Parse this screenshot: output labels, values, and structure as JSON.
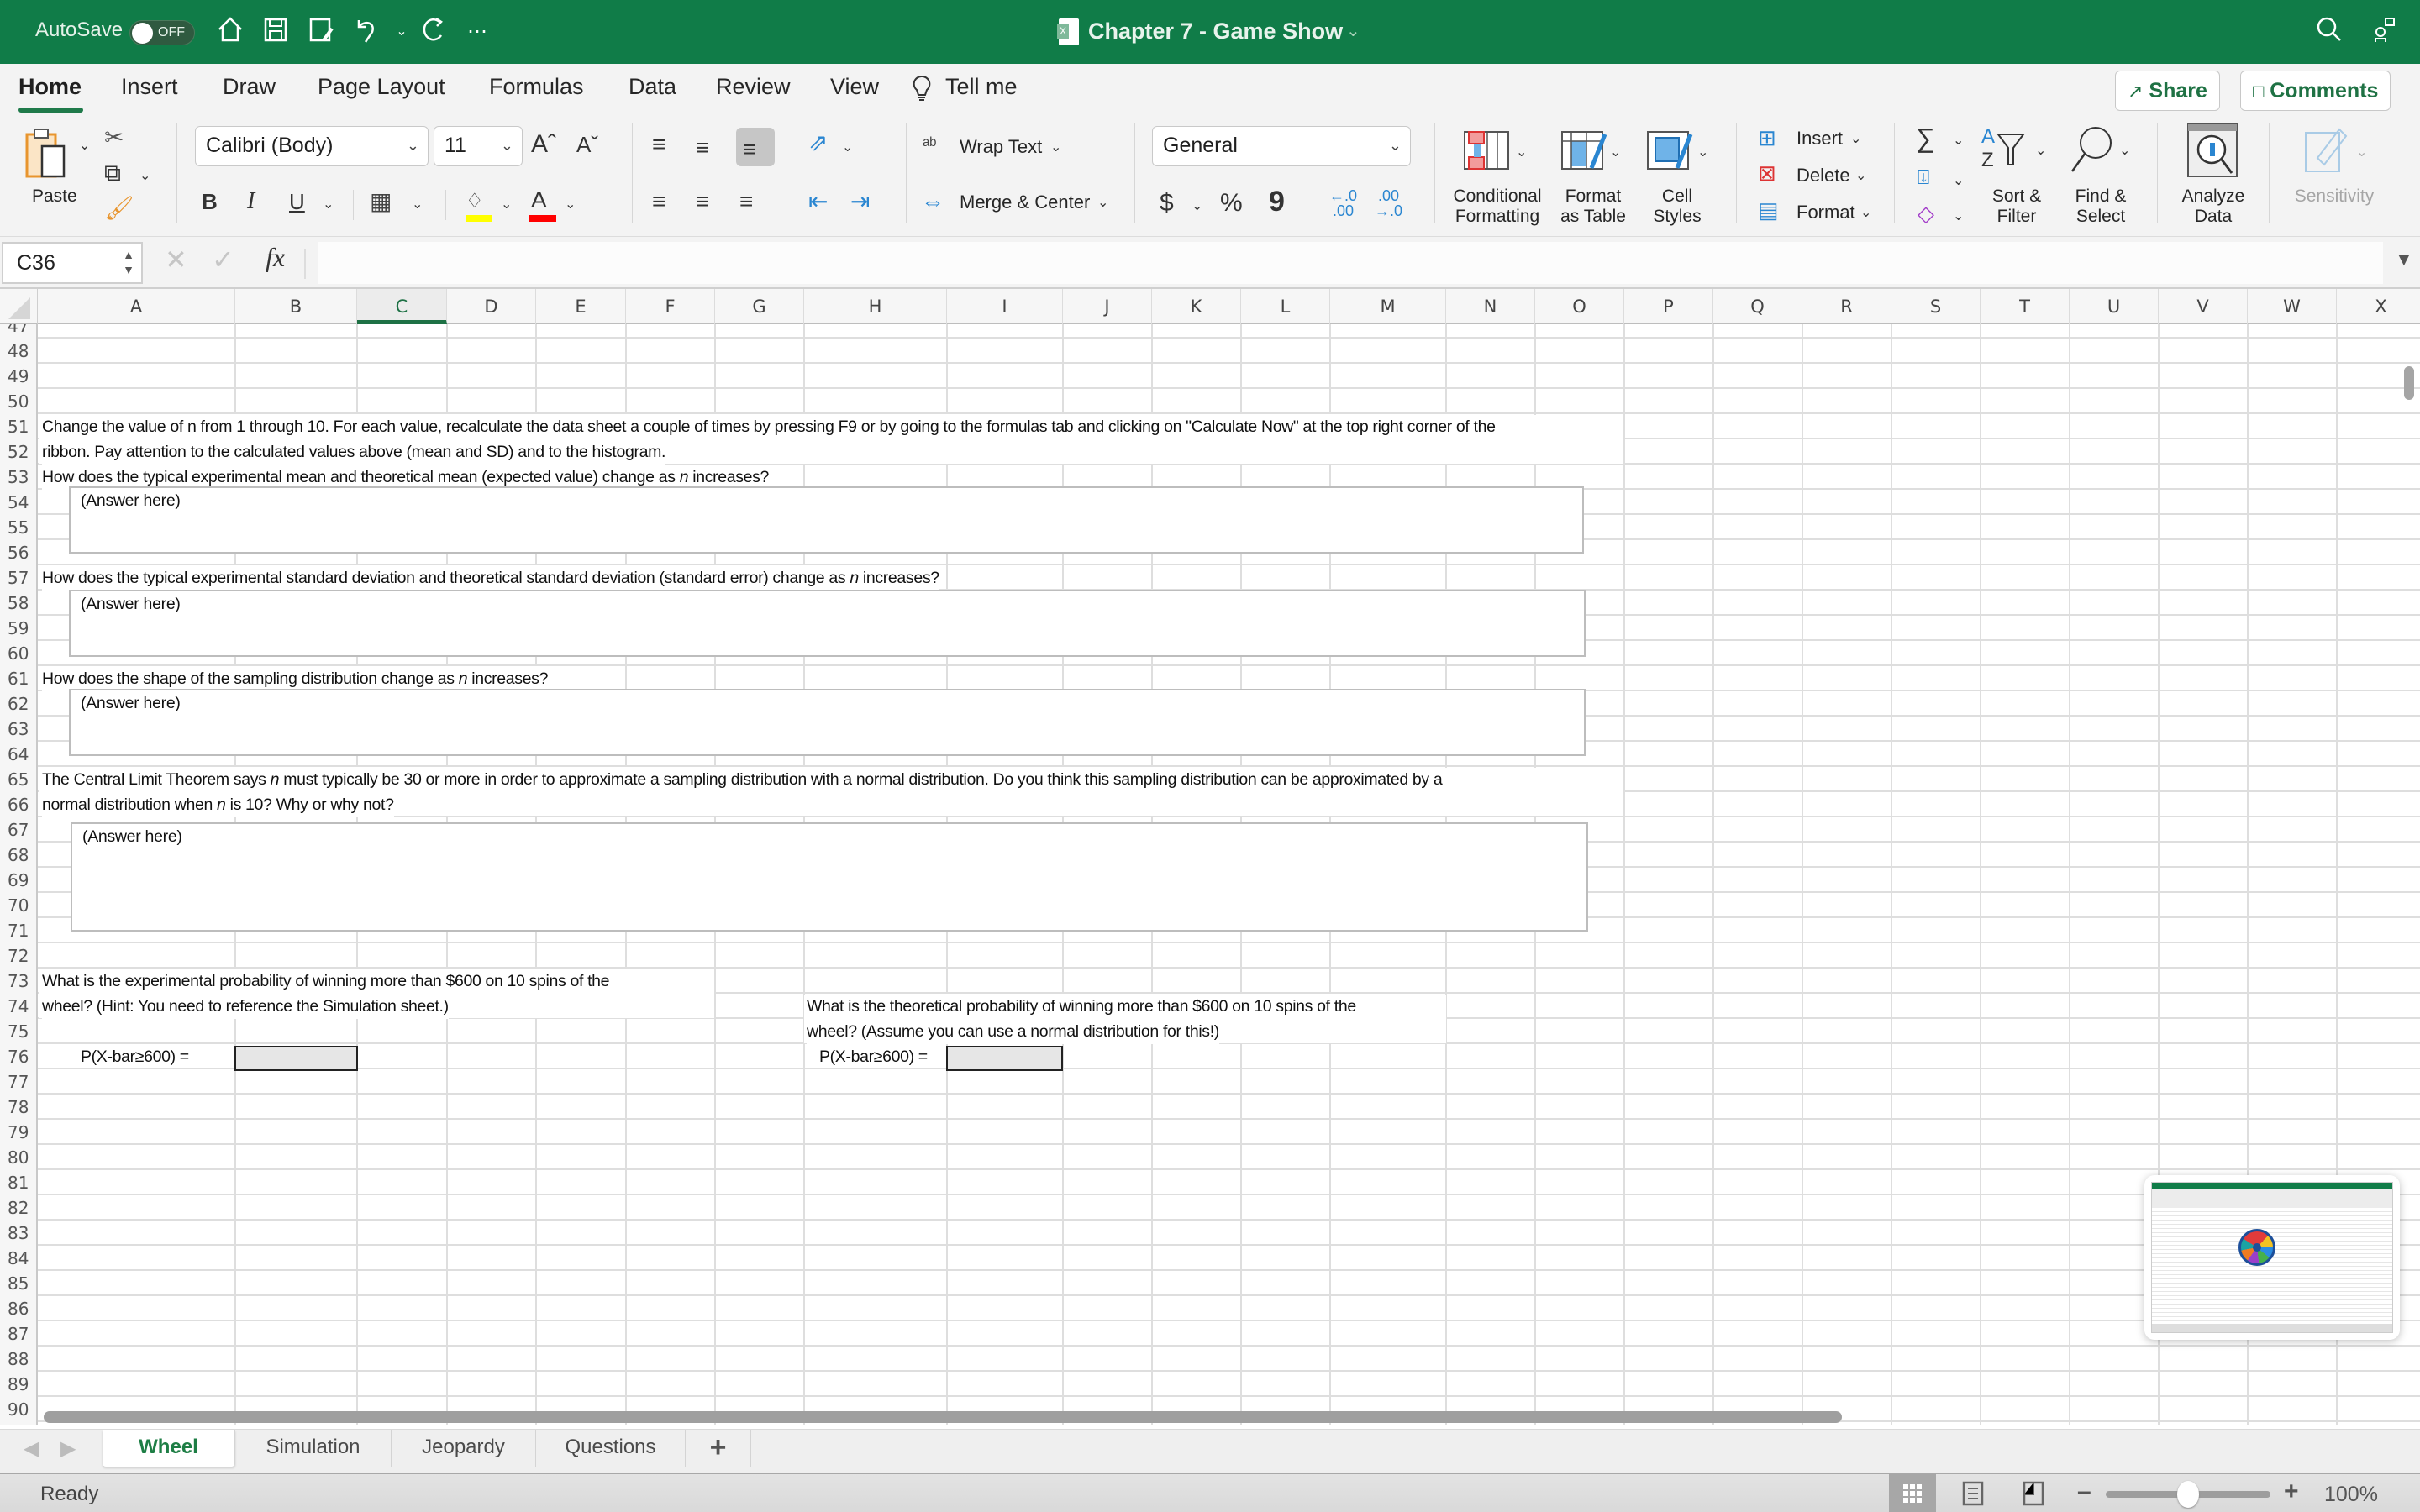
{
  "titlebar": {
    "autosave_label": "AutoSave",
    "autosave_state": "OFF",
    "document_title": "Chapter 7 - Game Show",
    "icons": [
      "home-icon",
      "save-icon",
      "save-as-icon",
      "undo-icon",
      "redo-icon",
      "more-icon",
      "search-icon",
      "share-people-icon"
    ]
  },
  "menu": {
    "tabs": [
      "Home",
      "Insert",
      "Draw",
      "Page Layout",
      "Formulas",
      "Data",
      "Review",
      "View"
    ],
    "active_tab": "Home",
    "tell_me": "Tell me",
    "share_label": "Share",
    "comments_label": "Comments"
  },
  "ribbon": {
    "paste_label": "Paste",
    "font_name": "Calibri (Body)",
    "font_size": "11",
    "bold": "B",
    "italic": "I",
    "underline": "U",
    "wrap_text": "Wrap Text",
    "merge_center": "Merge & Center",
    "number_format": "General",
    "currency": "$",
    "percent": "%",
    "comma": "9",
    "conditional_formatting": [
      "Conditional",
      "Formatting"
    ],
    "format_as_table": [
      "Format",
      "as Table"
    ],
    "cell_styles": [
      "Cell",
      "Styles"
    ],
    "insert": "Insert",
    "delete": "Delete",
    "format": "Format",
    "sort_filter": [
      "Sort &",
      "Filter"
    ],
    "find_select": [
      "Find &",
      "Select"
    ],
    "analyze_data": [
      "Analyze",
      "Data"
    ],
    "sensitivity": "Sensitivity",
    "colors": {
      "highlight": "#ffff00",
      "font_color": "#ff0000",
      "accent": "#107c48"
    }
  },
  "formula_bar": {
    "name_box": "C36",
    "formula": "",
    "fx_label": "fx"
  },
  "grid": {
    "columns": [
      "A",
      "B",
      "C",
      "D",
      "E",
      "F",
      "G",
      "H",
      "I",
      "J",
      "K",
      "L",
      "M",
      "N",
      "O",
      "P",
      "Q",
      "R",
      "S",
      "T",
      "U",
      "V",
      "W",
      "X"
    ],
    "selected_column": "C",
    "first_row": 47,
    "last_row": 90,
    "cells": {
      "r51": "Change the value of n from 1 through 10.  For each value, recalculate the data sheet a couple of times by pressing F9 or by going to the formulas tab and clicking on \"Calculate Now\"  at the top right corner of the",
      "r52": "ribbon.  Pay attention to the calculated values above (mean and SD) and to the histogram.",
      "r53_pre": "How does the typical experimental mean and theoretical mean (expected value) change as ",
      "r53_post": "  increases?",
      "r57_pre": "How does the typical experimental standard deviation and theoretical standard deviation (standard error) change as ",
      "r57_post": "  increases?",
      "r61_pre": "How does the shape of the sampling distribution change as ",
      "r61_post": "  increases?",
      "r65_pre": "The Central Limit Theorem says ",
      "r65_post": "  must typically be 30 or more in order to approximate a sampling distribution with a normal distribution.  Do you think this sampling distribution can be approximated by a",
      "r66_pre": "normal distribution when ",
      "r66_post": "  is 10?  Why or why not?",
      "italic_n": "n",
      "r73": "What is the experimental probability of winning more than $600 on 10 spins of the",
      "r74": "wheel? (Hint:  You need to reference the Simulation sheet.)",
      "r76_label": "P(X-bar≥600) =",
      "h74": "What is the theoretical probability of winning more than $600 on 10 spins of the",
      "h75": "wheel?  (Assume you can use a normal distribution for this!)",
      "h76_label": "P(X-bar≥600) ="
    },
    "answer_placeholder": "(Answer here)"
  },
  "sheet_tabs": {
    "tabs": [
      "Wheel",
      "Simulation",
      "Jeopardy",
      "Questions"
    ],
    "active": "Wheel",
    "add_label": "+"
  },
  "status_bar": {
    "status": "Ready",
    "zoom": "100%",
    "zoom_level_percent": 100,
    "view": "normal"
  }
}
